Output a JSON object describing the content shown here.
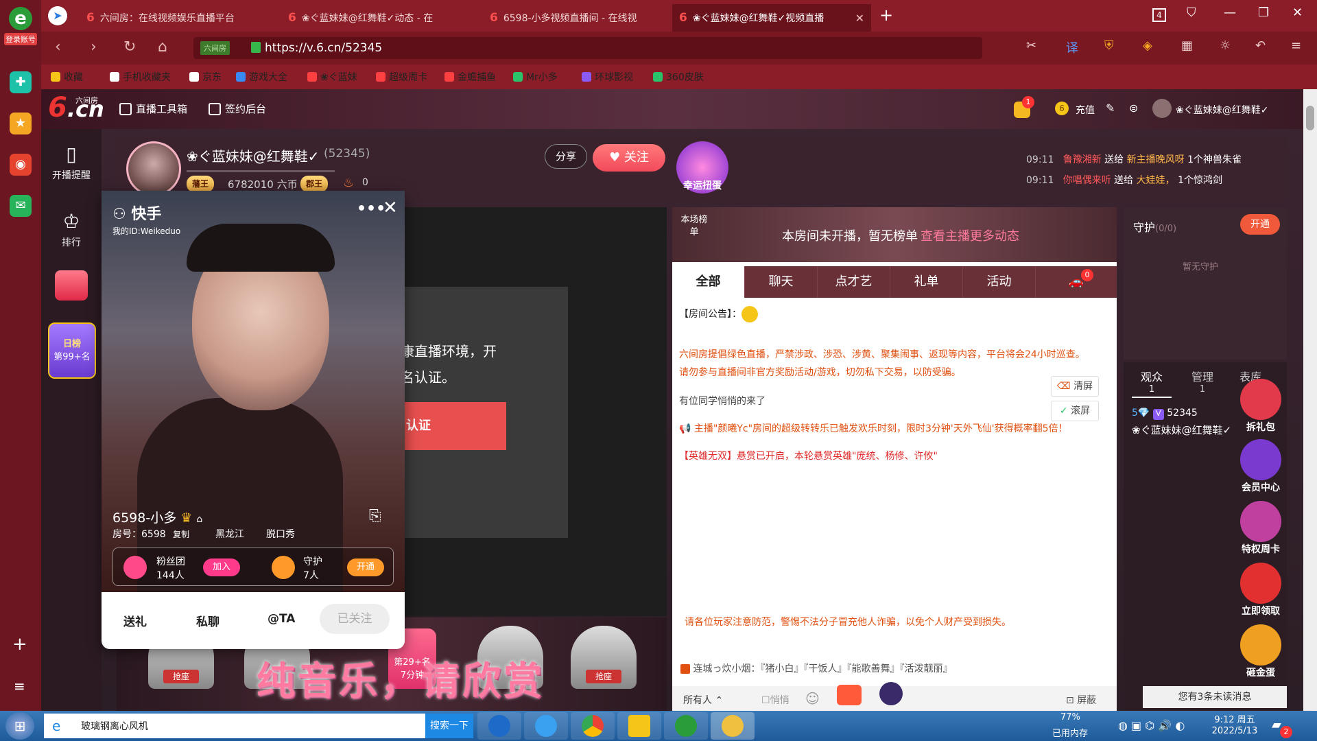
{
  "dock": {
    "login_label": "登录账号"
  },
  "tabs": [
    {
      "label": "六间房：在线视频娱乐直播平台"
    },
    {
      "label": "❀ぐ蓝妹妹@红舞鞋✓动态 - 在"
    },
    {
      "label": "6598-小多视频直播间 - 在线视"
    },
    {
      "label": "❀ぐ蓝妹妹@红舞鞋✓视频直播"
    }
  ],
  "window": {
    "tab_count": "4"
  },
  "address": {
    "url": "https://v.6.cn/52345",
    "site_tag": "六间房"
  },
  "bookmarks": [
    {
      "label": "收藏",
      "color": "#f5c518"
    },
    {
      "label": "手机收藏夹",
      "color": "#ffffff"
    },
    {
      "label": "京东",
      "color": "#ffffff"
    },
    {
      "label": "游戏大全",
      "color": "#3a8af5"
    },
    {
      "label": "❀ぐ蓝妹",
      "color": "#ff4040"
    },
    {
      "label": "超级周卡",
      "color": "#ff4040"
    },
    {
      "label": "金蟾捕鱼",
      "color": "#ff4040"
    },
    {
      "label": "Mr小多",
      "color": "#2ac36a"
    },
    {
      "label": "环球影视",
      "color": "#8a5af5"
    },
    {
      "label": "360皮肤",
      "color": "#2ac36a"
    }
  ],
  "site": {
    "logo_text": "6",
    "logo_suffix": ".cn",
    "logo_cn": "六间房",
    "toolbox": "直播工具箱",
    "signin": "签约后台",
    "recharge": "充值",
    "notif_count": "1",
    "user": "❀ぐ蓝妹妹@红舞鞋✓"
  },
  "sitenav": [
    {
      "label": "开播提醒"
    },
    {
      "label": "排行"
    }
  ],
  "sitenav_extra": {
    "daily_title": "日榜",
    "daily_rank": "第99+名"
  },
  "room": {
    "anchor": "❀ぐ蓝妹妹@红舞鞋✓",
    "room_id": "(52345)",
    "coins": "6782010 六币",
    "fire": "0",
    "badge1": "藩王",
    "badge2": "郡王",
    "share": "分享",
    "follow": "关注",
    "egg": "幸运扭蛋",
    "gifts": [
      {
        "time": "09:11",
        "user": "鲁豫湘新",
        "verb": "送给",
        "target": "新主播晚风呀",
        "item": "1个神兽朱雀"
      },
      {
        "time": "09:11",
        "user": "你唱偶来听",
        "verb": "送给",
        "target": "大娃娃，",
        "item": "1个惊鸿剑"
      }
    ]
  },
  "video": {
    "text1": "康直播环境，开",
    "text2": "名认证。",
    "btn": "认证"
  },
  "seats": [
    {
      "label": "抢座"
    },
    {
      "label": "抢座"
    }
  ],
  "banner": {
    "text": "纯音乐，请欣赏",
    "rank_tag": "第29+名",
    "duration": "7分钟"
  },
  "chat": {
    "rank_label": "本场榜单",
    "rank_text": "本房间未开播，暂无榜单",
    "rank_link": "查看主播更多动态",
    "tabs": [
      {
        "label": "全部"
      },
      {
        "label": "聊天"
      },
      {
        "label": "点才艺"
      },
      {
        "label": "礼单"
      },
      {
        "label": "活动"
      }
    ],
    "car_count": "0",
    "notice": "【房间公告】：",
    "rules": "六间房提倡绿色直播，严禁涉政、涉恐、涉黄、聚集闹事、返现等内容，平台将会24小时巡查。请勿参与直播间非官方奖励活动/游戏，切勿私下交易，以防受骗。",
    "arrival": "有位同学悄悄的来了",
    "broadcast": "主播\"颜曦Yc\"房间的超级转转乐已触发欢乐时刻，限时3分钟'天外飞仙'获得概率翻5倍！",
    "hero": "【英雄无双】悬赏已开启，本轮悬赏英雄\"庞统、杨修、许攸\"",
    "clear": "清屏",
    "scroll": "滚屏",
    "warn": "请各位玩家注意防范，警惕不法分子冒充他人诈骗，以免个人财产受到损失。",
    "linkrow": "连城っ炊小烟：『猪小白』『干饭人』『能歌善舞』『活泼靓丽』",
    "target": "所有人",
    "quiet": "悄悄",
    "shield": "屏蔽"
  },
  "guard": {
    "title": "守护",
    "count": "(0/0)",
    "open": "开通",
    "empty": "暂无守护"
  },
  "audience": {
    "tabs": [
      {
        "label": "观众",
        "count": "1"
      },
      {
        "label": "管理",
        "count": "1"
      },
      {
        "label": "表库",
        "count": ""
      }
    ],
    "user_level": "5",
    "user_id": "52345",
    "user_name": "❀ぐ蓝妹妹@红舞鞋✓",
    "unread": "您有3条未读消息"
  },
  "side_buttons": [
    {
      "label": "拆礼包",
      "color": "#e23a4a"
    },
    {
      "label": "会员中心",
      "color": "#7a3ad0"
    },
    {
      "label": "特权周卡",
      "color": "#c040a0"
    },
    {
      "label": "立即领取",
      "color": "#e23030"
    },
    {
      "label": "砸金蛋",
      "color": "#f0a020"
    }
  ],
  "popup": {
    "app": "快手",
    "my_id": "我的ID:Weikeduo",
    "name": "6598-小多",
    "room": "房号：6598",
    "copy": "复制",
    "province": "黑龙江",
    "tag": "脱口秀",
    "fans_label": "粉丝团",
    "fans_count": "144人",
    "join": "加入",
    "guard_label": "守护",
    "guard_count": "7人",
    "open": "开通",
    "actions": [
      {
        "label": "送礼"
      },
      {
        "label": "私聊"
      },
      {
        "label": "@TA"
      }
    ],
    "followed": "已关注"
  },
  "taskbar": {
    "search_text": "玻璃钢离心风机",
    "search_btn": "搜索一下",
    "mem_pct": "77%",
    "mem_label": "已用内存",
    "time": "9:12 周五",
    "date": "2022/5/13",
    "notif": "2"
  }
}
